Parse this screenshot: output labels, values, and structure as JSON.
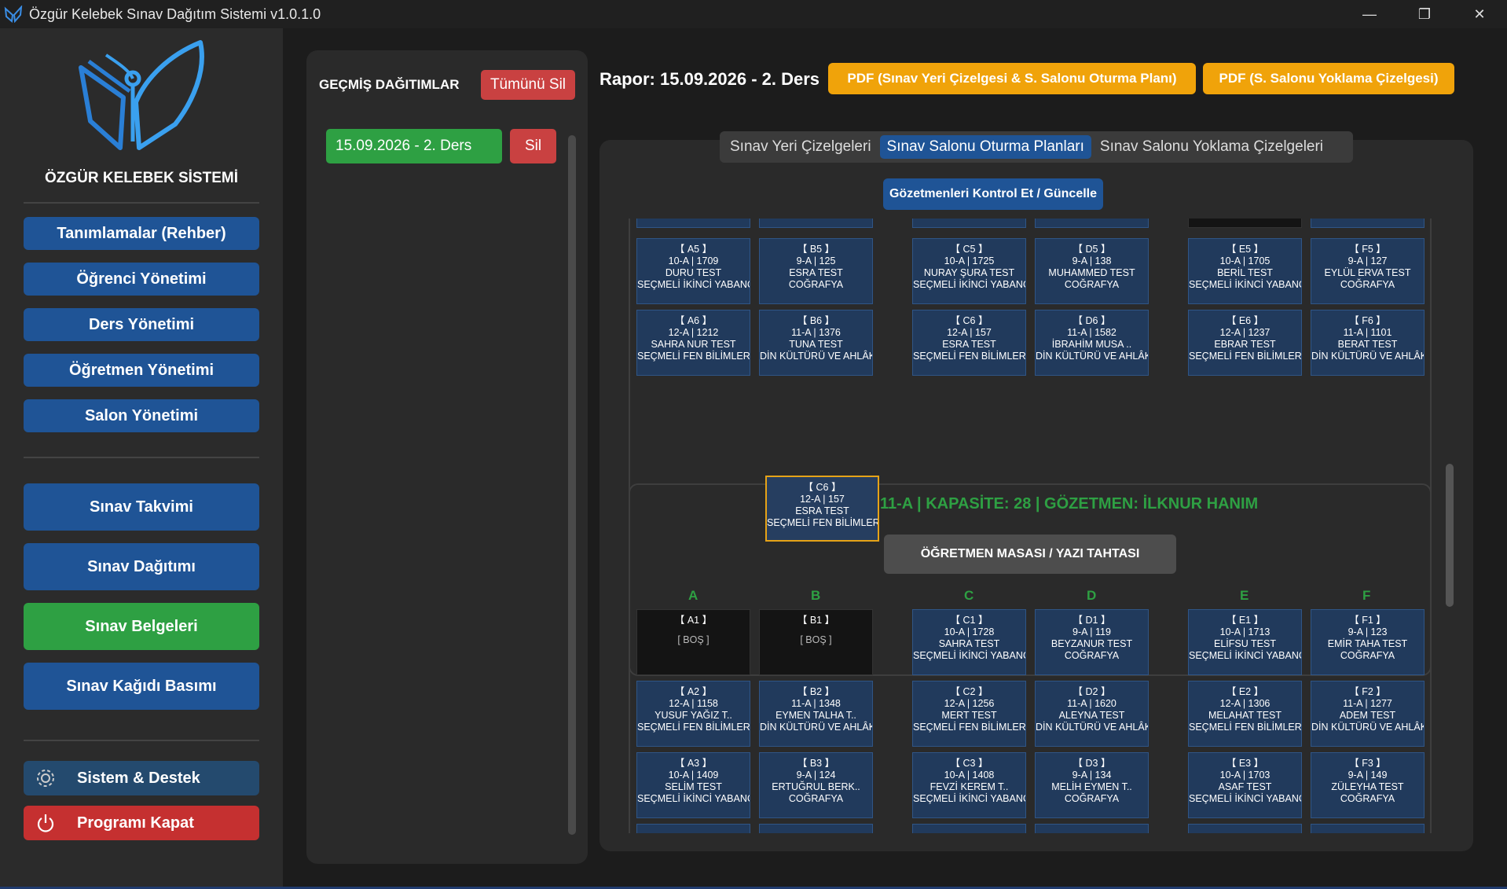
{
  "window": {
    "title": "Özgür Kelebek Sınav Dağıtım Sistemi v1.0.1.0"
  },
  "sidebar": {
    "brand": "ÖZGÜR KELEBEK SİSTEMİ",
    "items": [
      {
        "label": "Tanımlamalar (Rehber)"
      },
      {
        "label": "Öğrenci Yönetimi"
      },
      {
        "label": "Ders Yönetimi"
      },
      {
        "label": "Öğretmen Yönetimi"
      },
      {
        "label": "Salon Yönetimi"
      },
      {
        "label": "Sınav Takvimi"
      },
      {
        "label": "Sınav Dağıtımı"
      },
      {
        "label": "Sınav Belgeleri"
      },
      {
        "label": "Sınav Kağıdı Basımı"
      }
    ],
    "system": "Sistem & Destek",
    "exit": "Programı Kapat"
  },
  "history": {
    "title": "GEÇMİŞ DAĞITIMLAR",
    "delete_all": "Tümünü Sil",
    "items": [
      {
        "label": "15.09.2026 - 2. Ders",
        "delete": "Sil"
      }
    ]
  },
  "report": {
    "title": "Rapor: 15.09.2026 - 2. Ders",
    "pdf1": "PDF (Sınav Yeri Çizelgesi & S. Salonu Oturma Planı)",
    "pdf2": "PDF (S. Salonu Yoklama Çizelgesi)"
  },
  "tabs": [
    "Sınav Yeri Çizelgeleri",
    "Sınav Salonu Oturma Planları",
    "Sınav Salonu Yoklama Çizelgeleri"
  ],
  "gozetmen_button": "Gözetmenleri Kontrol Et / Güncelle",
  "salon2": {
    "title": "11-A | KAPASİTE: 28 | GÖZETMEN: İLKNUR HANIM",
    "desk": "ÖĞRETMEN MASASI / YAZI TAHTASI",
    "columns": [
      "A",
      "B",
      "C",
      "D",
      "E",
      "F"
    ]
  },
  "top_rows": [
    [
      {
        "id": "【 A5 】",
        "l1": "10-A | 1709",
        "l2": "DURU TEST",
        "l3": "SEÇMELİ İKİNCİ YABANCI DİL"
      },
      {
        "id": "【 B5 】",
        "l1": "9-A | 125",
        "l2": "ESRA TEST",
        "l3": "COĞRAFYA"
      },
      {
        "id": "【 C5 】",
        "l1": "10-A | 1725",
        "l2": "NURAY ŞURA TEST",
        "l3": "SEÇMELİ İKİNCİ YABANCI DİL"
      },
      {
        "id": "【 D5 】",
        "l1": "9-A | 138",
        "l2": "MUHAMMED TEST",
        "l3": "COĞRAFYA"
      },
      {
        "id": "【 E5 】",
        "l1": "10-A | 1705",
        "l2": "BERİL TEST",
        "l3": "SEÇMELİ İKİNCİ YABANCI DİL"
      },
      {
        "id": "【 F5 】",
        "l1": "9-A | 127",
        "l2": "EYLÜL ERVA TEST",
        "l3": "COĞRAFYA"
      }
    ],
    [
      {
        "id": "【 A6 】",
        "l1": "12-A | 1212",
        "l2": "SAHRA NUR TEST",
        "l3": "SEÇMELİ FEN BİLİMLERİ UYGULAMALARI"
      },
      {
        "id": "【 B6 】",
        "l1": "11-A | 1376",
        "l2": "TUNA TEST",
        "l3": "DİN KÜLTÜRÜ VE AHLÂK BİLGİSİ"
      },
      {
        "id": "【 C6 】",
        "l1": "12-A | 157",
        "l2": "ESRA TEST",
        "l3": "SEÇMELİ FEN BİLİMLERİ UYGULAMALARI"
      },
      {
        "id": "【 D6 】",
        "l1": "11-A | 1582",
        "l2": "İBRAHİM MUSA ..",
        "l3": "DİN KÜLTÜRÜ VE AHLÂK BİLGİSİ"
      },
      {
        "id": "【 E6 】",
        "l1": "12-A | 1237",
        "l2": "EBRAR TEST",
        "l3": "SEÇMELİ FEN BİLİMLERİ UYGULAMALARI"
      },
      {
        "id": "【 F6 】",
        "l1": "11-A | 1101",
        "l2": "BERAT TEST",
        "l3": "DİN KÜLTÜRÜ VE AHLÂK BİLGİSİ"
      }
    ]
  ],
  "ghost_seat": {
    "id": "【 C6 】",
    "l1": "12-A | 157",
    "l2": "ESRA TEST",
    "l3": "SEÇMELİ FEN BİLİMLERİ UYGULAMALARI"
  },
  "bottom_rows": [
    [
      {
        "id": "【 A1 】",
        "empty": "[ BOŞ ]"
      },
      {
        "id": "【 B1 】",
        "empty": "[ BOŞ ]"
      },
      {
        "id": "【 C1 】",
        "l1": "10-A | 1728",
        "l2": "SAHRA TEST",
        "l3": "SEÇMELİ İKİNCİ YABANCI DİL"
      },
      {
        "id": "【 D1 】",
        "l1": "9-A | 119",
        "l2": "BEYZANUR TEST",
        "l3": "COĞRAFYA"
      },
      {
        "id": "【 E1 】",
        "l1": "10-A | 1713",
        "l2": "ELİFSU TEST",
        "l3": "SEÇMELİ İKİNCİ YABANCI DİL"
      },
      {
        "id": "【 F1 】",
        "l1": "9-A | 123",
        "l2": "EMİR TAHA TEST",
        "l3": "COĞRAFYA"
      }
    ],
    [
      {
        "id": "【 A2 】",
        "l1": "12-A | 1158",
        "l2": "YUSUF YAĞIZ T..",
        "l3": "SEÇMELİ FEN BİLİMLERİ UYGULAMALARI"
      },
      {
        "id": "【 B2 】",
        "l1": "11-A | 1348",
        "l2": "EYMEN TALHA T..",
        "l3": "DİN KÜLTÜRÜ VE AHLÂK BİLGİSİ"
      },
      {
        "id": "【 C2 】",
        "l1": "12-A | 1256",
        "l2": "MERT TEST",
        "l3": "SEÇMELİ FEN BİLİMLERİ UYGULAMALARI"
      },
      {
        "id": "【 D2 】",
        "l1": "11-A | 1620",
        "l2": "ALEYNA TEST",
        "l3": "DİN KÜLTÜRÜ VE AHLÂK BİLGİSİ"
      },
      {
        "id": "【 E2 】",
        "l1": "12-A | 1306",
        "l2": "MELAHAT TEST",
        "l3": "SEÇMELİ FEN BİLİMLERİ UYGULAMALARI"
      },
      {
        "id": "【 F2 】",
        "l1": "11-A | 1277",
        "l2": "ADEM TEST",
        "l3": "DİN KÜLTÜRÜ VE AHLÂK BİLGİSİ"
      }
    ],
    [
      {
        "id": "【 A3 】",
        "l1": "10-A | 1409",
        "l2": "SELİM TEST",
        "l3": "SEÇMELİ İKİNCİ YABANCI DİL"
      },
      {
        "id": "【 B3 】",
        "l1": "9-A | 124",
        "l2": "ERTUĞRUL BERK..",
        "l3": "COĞRAFYA"
      },
      {
        "id": "【 C3 】",
        "l1": "10-A | 1408",
        "l2": "FEVZİ KEREM T..",
        "l3": "SEÇMELİ İKİNCİ YABANCI DİL"
      },
      {
        "id": "【 D3 】",
        "l1": "9-A | 134",
        "l2": "MELİH EYMEN T..",
        "l3": "COĞRAFYA"
      },
      {
        "id": "【 E3 】",
        "l1": "10-A | 1703",
        "l2": "ASAF TEST",
        "l3": "SEÇMELİ İKİNCİ YABANCI DİL"
      },
      {
        "id": "【 F3 】",
        "l1": "9-A | 149",
        "l2": "ZÜLEYHA TEST",
        "l3": "COĞRAFYA"
      }
    ]
  ]
}
